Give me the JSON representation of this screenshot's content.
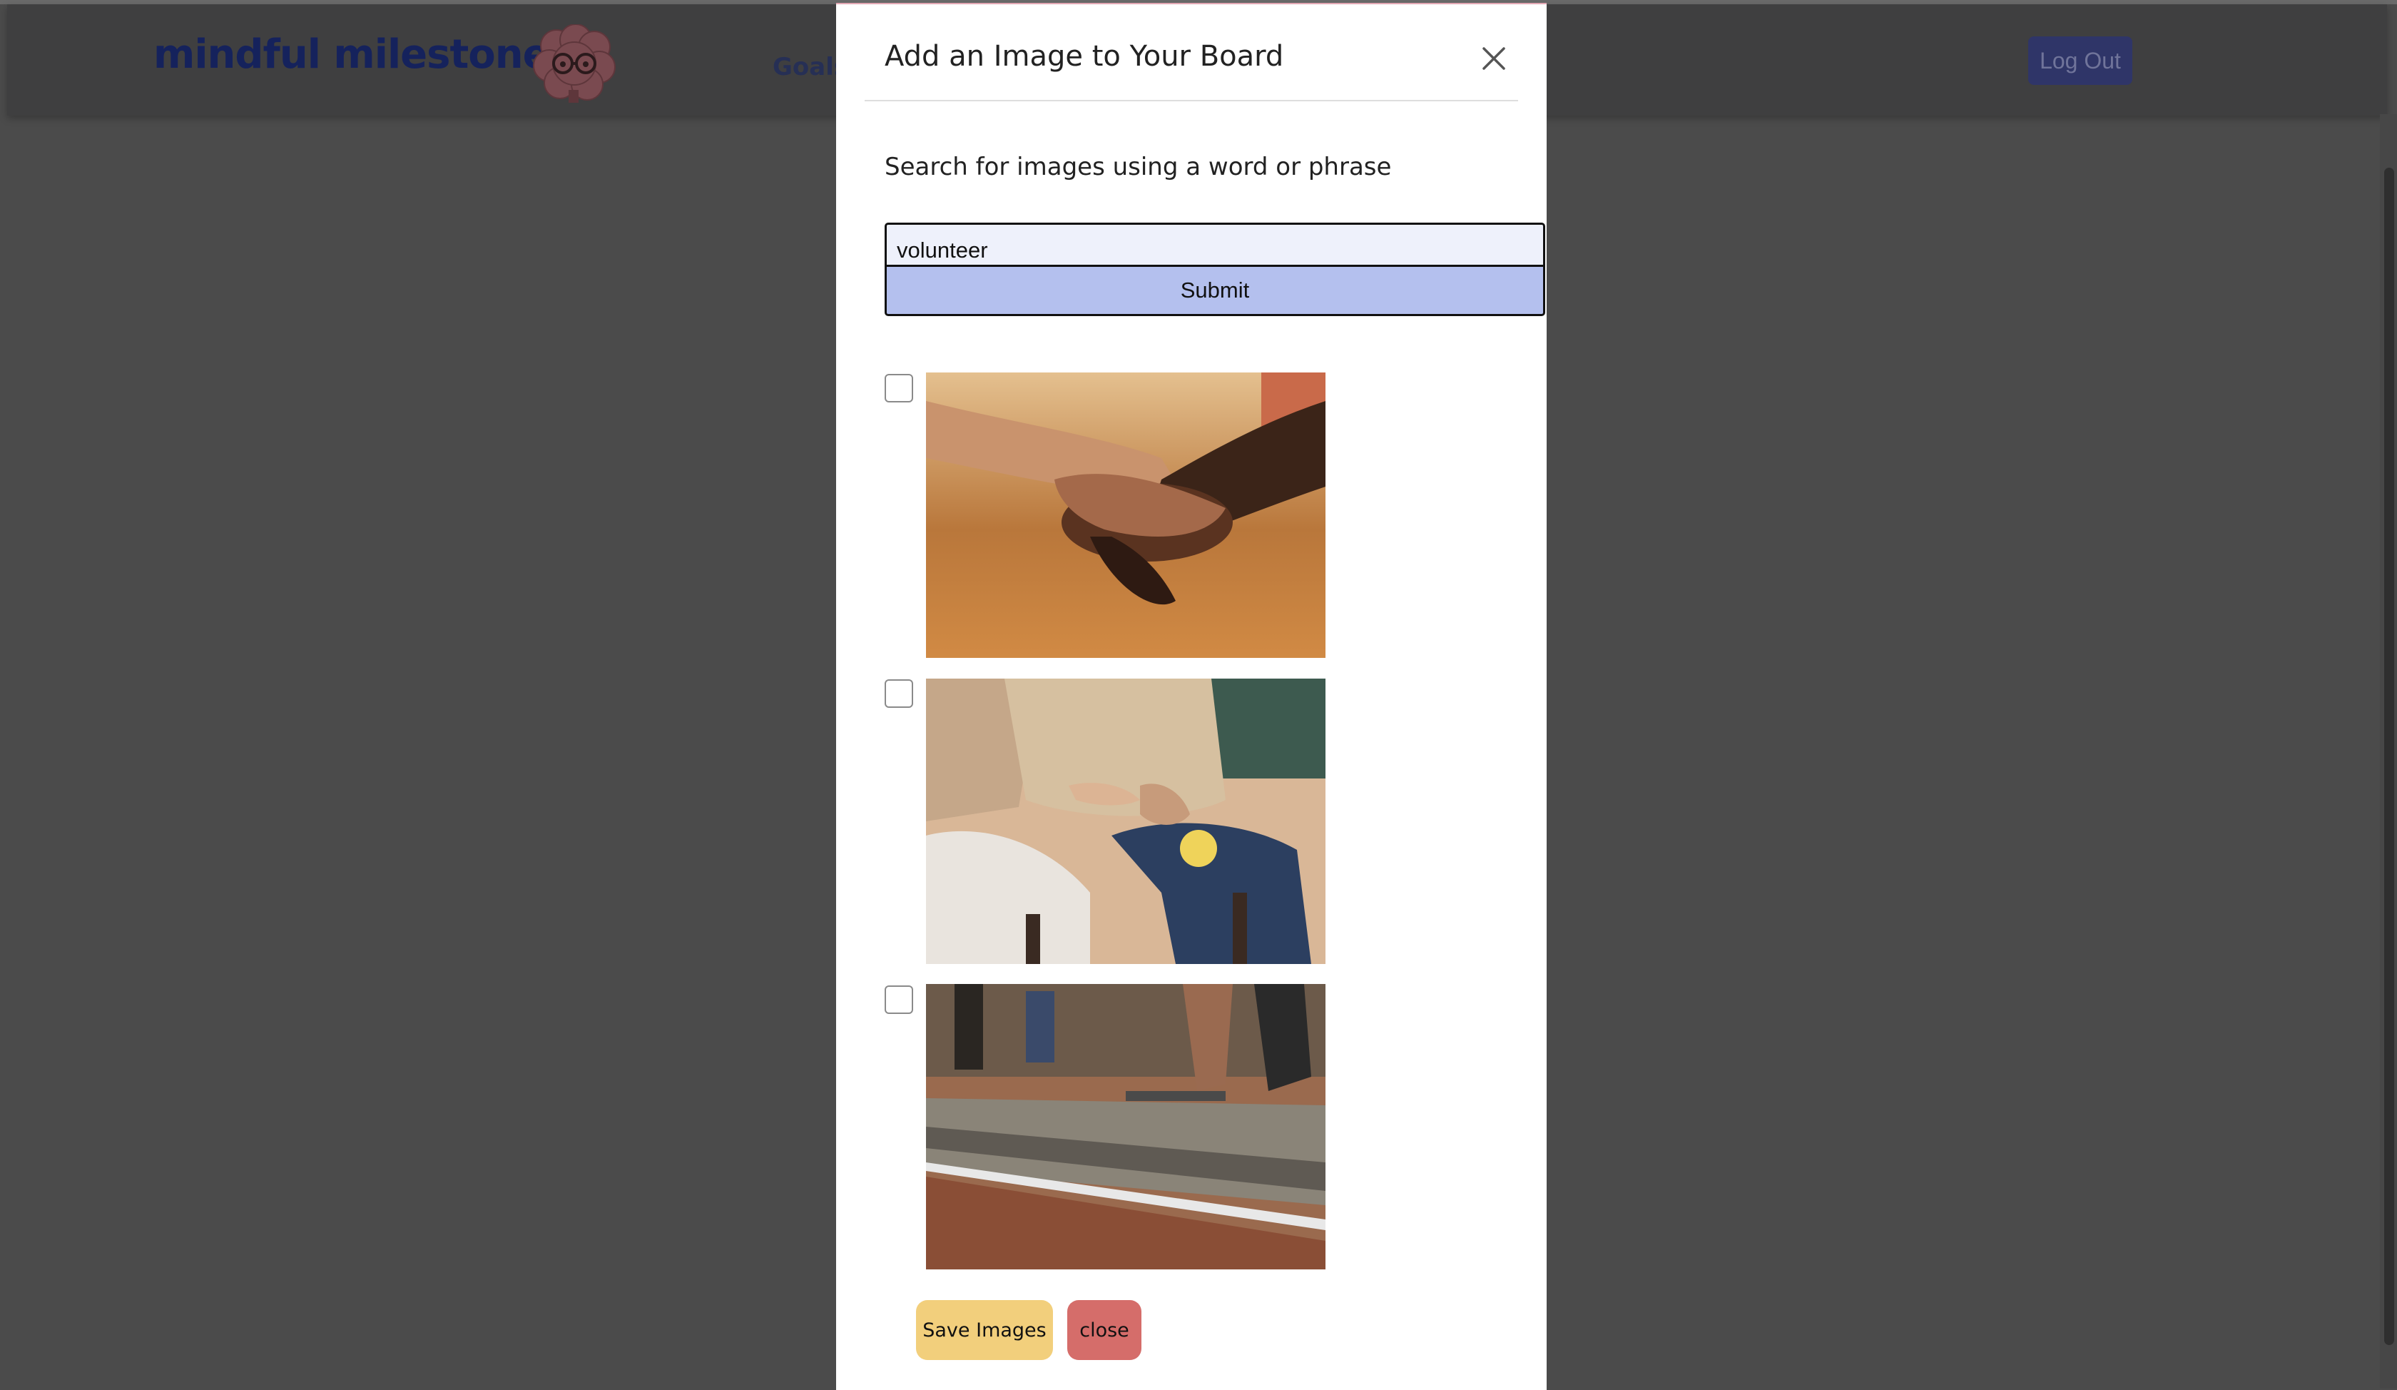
{
  "app": {
    "logo_text": "mindful milestones",
    "nav": {
      "goals_label": "Goals"
    },
    "logout_label": "Log Out"
  },
  "modal": {
    "title": "Add an Image to Your Board",
    "search_label": "Search for images using a word or phrase",
    "search_value": "volunteer",
    "submit_label": "Submit",
    "results": [
      {
        "icon": "holding-hands-photo",
        "checked": false
      },
      {
        "icon": "elderly-care-photo",
        "checked": false
      },
      {
        "icon": "concrete-volunteer-photo",
        "checked": false
      }
    ],
    "save_label": "Save Images",
    "close_label": "close"
  },
  "colors": {
    "overlay": "#4b4b4b",
    "logo": "#15225c",
    "logout_bg": "#2f3568",
    "submit_bg": "#b4c0ee",
    "save_bg": "#f2cf7c",
    "close_bg": "#d56d6a"
  }
}
